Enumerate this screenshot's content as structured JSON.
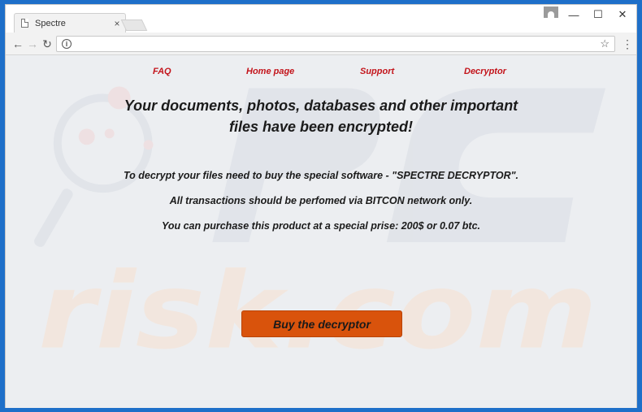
{
  "browser": {
    "tab_title": "Spectre",
    "tab_close": "×",
    "address": "",
    "controls": {
      "minimize": "—",
      "maximize": "☐",
      "close": "✕"
    },
    "nav": {
      "back": "←",
      "forward": "→",
      "reload": "↻",
      "info": "i",
      "star": "☆",
      "menu": "⋮"
    }
  },
  "page": {
    "nav_links": [
      "FAQ",
      "Home page",
      "Support",
      "Decryptor"
    ],
    "headline_line1": "Your documents, photos, databases and other important",
    "headline_line2": "files have been encrypted!",
    "paragraph1": "To decrypt your files need to buy the special software - \"SPECTRE DECRYPTOR\".",
    "paragraph2": "All transactions should be perfomed via BITCON network only.",
    "paragraph3": "You can purchase this product at a special prise: 200$ or 0.07 btc.",
    "button_label": "Buy the decryptor"
  },
  "colors": {
    "nav_link": "#c3141b",
    "button": "#d9530c",
    "page_bg": "#eceef1",
    "frame": "#1e6fc9"
  },
  "watermark": "risk.com"
}
